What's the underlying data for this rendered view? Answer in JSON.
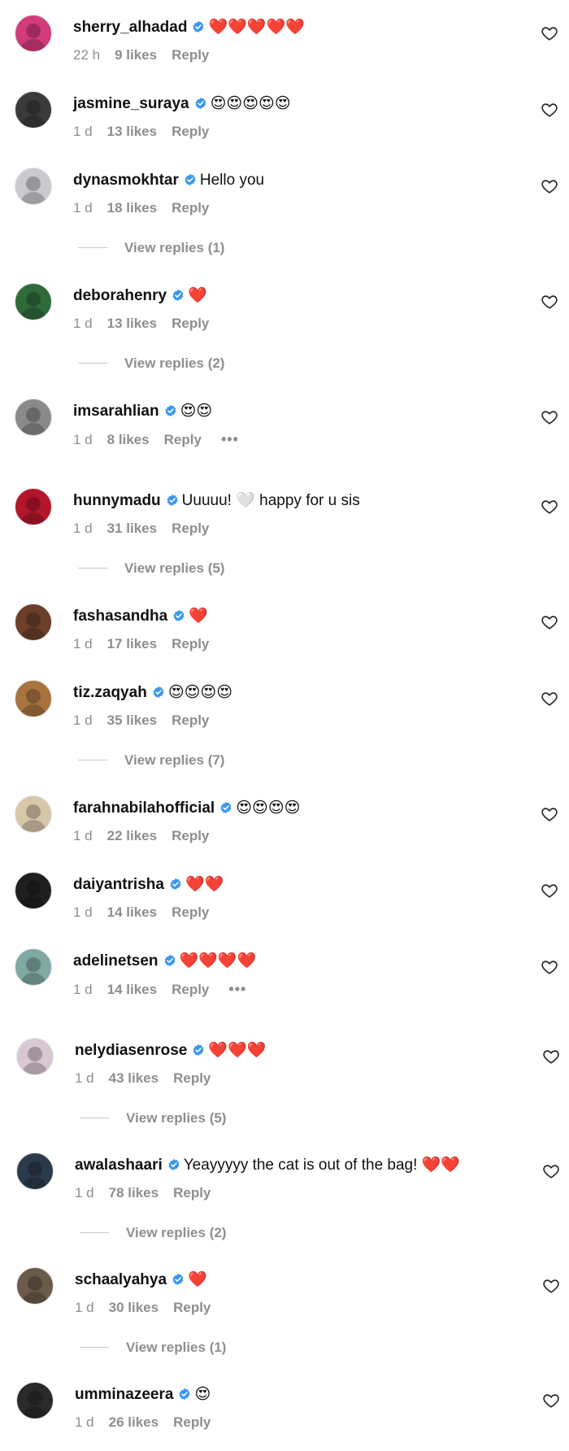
{
  "colors": {
    "verified": "#3897f0",
    "muted": "#8e8e8e",
    "heart": "#ed4956"
  },
  "comments": [
    {
      "username": "sherry_alhadad",
      "text": "❤️❤️❤️❤️❤️",
      "time": "22 h",
      "likes": "9 likes",
      "reply": "Reply",
      "avatar_color": "#d23b7a"
    },
    {
      "username": "jasmine_suraya",
      "text": "😍😍😍😍😍",
      "time": "1 d",
      "likes": "13 likes",
      "reply": "Reply",
      "avatar_color": "#3a3a3a"
    },
    {
      "username": "dynasmokhtar",
      "text": "Hello you",
      "time": "1 d",
      "likes": "18 likes",
      "reply": "Reply",
      "avatar_color": "#c9c9cf"
    },
    {
      "username": "deborahenry",
      "text": "❤️",
      "time": "1 d",
      "likes": "13 likes",
      "reply": "Reply",
      "avatar_color": "#2f6b3a"
    },
    {
      "username": "imsarahlian",
      "text": "😍😍",
      "time": "1 d",
      "likes": "8 likes",
      "reply": "Reply",
      "avatar_color": "#8a8a8a",
      "more": "•••"
    },
    {
      "username": "hunnymadu",
      "text": "Uuuuu! 🤍 happy for u sis",
      "time": "1 d",
      "likes": "31 likes",
      "reply": "Reply",
      "avatar_color": "#b3162a"
    },
    {
      "username": "fashasandha",
      "text": "❤️",
      "time": "1 d",
      "likes": "17 likes",
      "reply": "Reply",
      "avatar_color": "#6b3f2a"
    },
    {
      "username": "tiz.zaqyah",
      "text": "😍😍😍😍",
      "time": "1 d",
      "likes": "35 likes",
      "reply": "Reply",
      "avatar_color": "#a8733f"
    },
    {
      "username": "farahnabilahofficial",
      "text": "😍😍😍😍",
      "time": "1 d",
      "likes": "22 likes",
      "reply": "Reply",
      "avatar_color": "#d8c6a8"
    },
    {
      "username": "daiyantrisha",
      "text": "❤️❤️",
      "time": "1 d",
      "likes": "14 likes",
      "reply": "Reply",
      "avatar_color": "#1f1f1f"
    },
    {
      "username": "adelinetsen",
      "text": "❤️❤️❤️❤️",
      "time": "1 d",
      "likes": "14 likes",
      "reply": "Reply",
      "avatar_color": "#7fa9a4",
      "more": "•••"
    },
    {
      "username": "nelydiasenrose",
      "text": "❤️❤️❤️",
      "time": "1 d",
      "likes": "43 likes",
      "reply": "Reply",
      "avatar_color": "#d9c7d3"
    },
    {
      "username": "awalashaari",
      "text": "Yeayyyyy the cat is out of the bag! ❤️❤️",
      "time": "1 d",
      "likes": "78 likes",
      "reply": "Reply",
      "avatar_color": "#2b3a4a"
    },
    {
      "username": "schaalyahya",
      "text": "❤️",
      "time": "1 d",
      "likes": "30 likes",
      "reply": "Reply",
      "avatar_color": "#6a5a4a"
    },
    {
      "username": "umminazeera",
      "text": "😍",
      "time": "1 d",
      "likes": "26 likes",
      "reply": "Reply",
      "avatar_color": "#2a2a2a"
    }
  ],
  "view_replies": [
    "View replies (1)",
    "View replies (2)",
    "View replies (5)",
    "View replies (7)",
    "View replies (5)",
    "View replies (2)",
    "View replies (1)"
  ]
}
